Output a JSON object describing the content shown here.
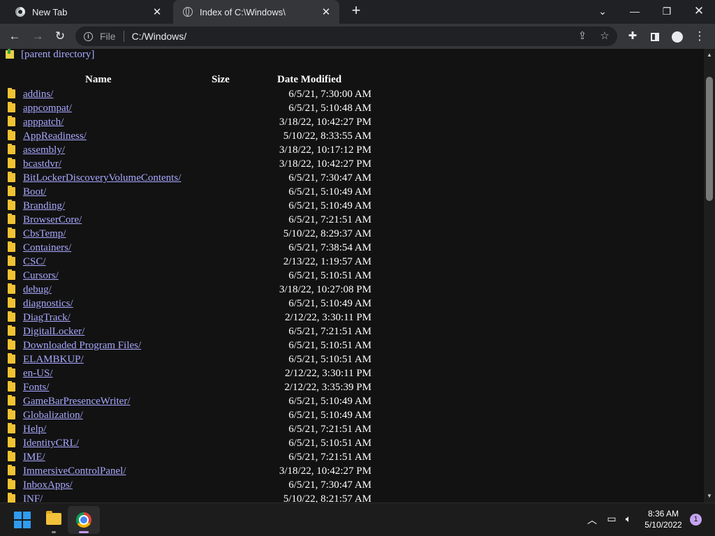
{
  "tabs": [
    {
      "title": "New Tab",
      "active": false
    },
    {
      "title": "Index of C:\\Windows\\",
      "active": true
    }
  ],
  "toolbar": {
    "scheme_label": "File",
    "url": "C:/Windows/"
  },
  "listing": {
    "parent_link": "[parent directory]",
    "headers": {
      "name": "Name",
      "size": "Size",
      "date": "Date Modified"
    },
    "rows": [
      {
        "name": "addins/",
        "date": "6/5/21, 7:30:00 AM"
      },
      {
        "name": "appcompat/",
        "date": "6/5/21, 5:10:48 AM"
      },
      {
        "name": "apppatch/",
        "date": "3/18/22, 10:42:27 PM"
      },
      {
        "name": "AppReadiness/",
        "date": "5/10/22, 8:33:55 AM"
      },
      {
        "name": "assembly/",
        "date": "3/18/22, 10:17:12 PM"
      },
      {
        "name": "bcastdvr/",
        "date": "3/18/22, 10:42:27 PM"
      },
      {
        "name": "BitLockerDiscoveryVolumeContents/",
        "date": "6/5/21, 7:30:47 AM"
      },
      {
        "name": "Boot/",
        "date": "6/5/21, 5:10:49 AM"
      },
      {
        "name": "Branding/",
        "date": "6/5/21, 5:10:49 AM"
      },
      {
        "name": "BrowserCore/",
        "date": "6/5/21, 7:21:51 AM"
      },
      {
        "name": "CbsTemp/",
        "date": "5/10/22, 8:29:37 AM"
      },
      {
        "name": "Containers/",
        "date": "6/5/21, 7:38:54 AM"
      },
      {
        "name": "CSC/",
        "date": "2/13/22, 1:19:57 AM"
      },
      {
        "name": "Cursors/",
        "date": "6/5/21, 5:10:51 AM"
      },
      {
        "name": "debug/",
        "date": "3/18/22, 10:27:08 PM"
      },
      {
        "name": "diagnostics/",
        "date": "6/5/21, 5:10:49 AM"
      },
      {
        "name": "DiagTrack/",
        "date": "2/12/22, 3:30:11 PM"
      },
      {
        "name": "DigitalLocker/",
        "date": "6/5/21, 7:21:51 AM"
      },
      {
        "name": "Downloaded Program Files/",
        "date": "6/5/21, 5:10:51 AM"
      },
      {
        "name": "ELAMBKUP/",
        "date": "6/5/21, 5:10:51 AM"
      },
      {
        "name": "en-US/",
        "date": "2/12/22, 3:30:11 PM"
      },
      {
        "name": "Fonts/",
        "date": "2/12/22, 3:35:39 PM"
      },
      {
        "name": "GameBarPresenceWriter/",
        "date": "6/5/21, 5:10:49 AM"
      },
      {
        "name": "Globalization/",
        "date": "6/5/21, 5:10:49 AM"
      },
      {
        "name": "Help/",
        "date": "6/5/21, 7:21:51 AM"
      },
      {
        "name": "IdentityCRL/",
        "date": "6/5/21, 5:10:51 AM"
      },
      {
        "name": "IME/",
        "date": "6/5/21, 7:21:51 AM"
      },
      {
        "name": "ImmersiveControlPanel/",
        "date": "3/18/22, 10:42:27 PM"
      },
      {
        "name": "InboxApps/",
        "date": "6/5/21, 7:30:47 AM"
      },
      {
        "name": "INF/",
        "date": "5/10/22, 8:21:57 AM"
      }
    ]
  },
  "taskbar": {
    "time": "8:36 AM",
    "date": "5/10/2022",
    "notification_count": "1"
  },
  "colors": {
    "link": "#a8a8ff",
    "folder": "#f1c232",
    "page_bg": "#121212"
  }
}
